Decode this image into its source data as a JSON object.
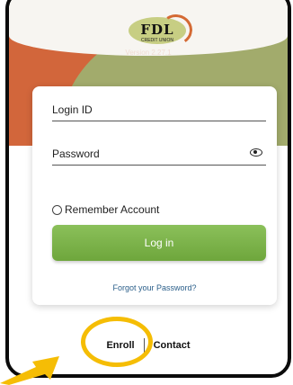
{
  "logo": {
    "text": "FDL",
    "subtext": "CREDIT UNION"
  },
  "version": "Version 2.27.1",
  "form": {
    "login_id_placeholder": "Login ID",
    "password_placeholder": "Password",
    "remember_label": "Remember Account",
    "login_button": "Log in",
    "forgot_link": "Forgot your Password?"
  },
  "footer": {
    "enroll": "Enroll",
    "contact": "Contact"
  },
  "icons": {
    "show_password": "eye-icon",
    "annotation": "arrow-icon"
  },
  "colors": {
    "accent_green": "#6ea63c",
    "highlight": "#f5bd05",
    "link": "#2b5f8a",
    "hero_orange": "#d2663b",
    "hero_green": "#a2ab6c"
  }
}
